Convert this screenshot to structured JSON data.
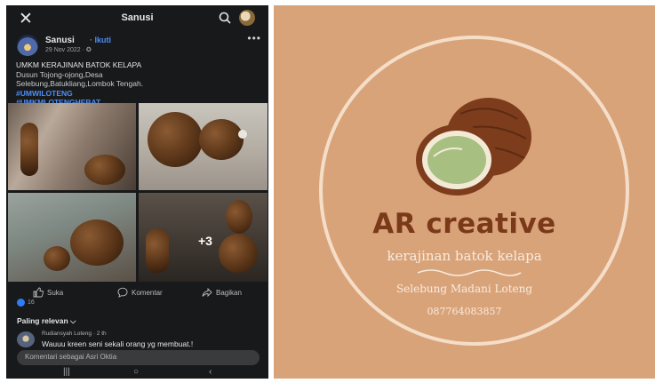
{
  "post": {
    "topbar": {
      "close": "✕",
      "title": "Sanusi"
    },
    "author": {
      "name": "Sanusi",
      "follow": "· Ikuti",
      "date": "29 Nov 2022 · ✪",
      "more": "•••"
    },
    "caption": {
      "line1": "UMKM KERAJINAN BATOK KELAPA",
      "line2": "Dusun Tojong-ojong,Desa",
      "line3": "Selebung,Batukliang,Lombok Tengah.",
      "tag1": "#UMWILOTENG",
      "tag2": "#UMKMLOTENGHEBAT"
    },
    "photos": {
      "more_count": "+3"
    },
    "actions": {
      "like": "Suka",
      "comment": "Komentar",
      "share": "Bagikan"
    },
    "reactions": {
      "count": "16"
    },
    "sort": {
      "label": "Paling relevan ⌵"
    },
    "comments": [
      {
        "author": "Rudiansyah Loteng · 2 th",
        "text": "Wauuu kreen seni sekali orang yg membuat.!"
      }
    ],
    "comment_input": {
      "placeholder": "Komentari sebagai Asri Oktia"
    },
    "nav": {
      "recent": "|||",
      "home": "○",
      "back": "‹"
    }
  },
  "logo": {
    "brand": "AR creative",
    "subtitle": "kerajinan batok kelapa",
    "location": "Selebung Madani Loteng",
    "phone": "087764083857",
    "colors": {
      "background": "#d9a37a",
      "ring": "#f4dec8",
      "brand_text": "#7a3a1a"
    }
  }
}
